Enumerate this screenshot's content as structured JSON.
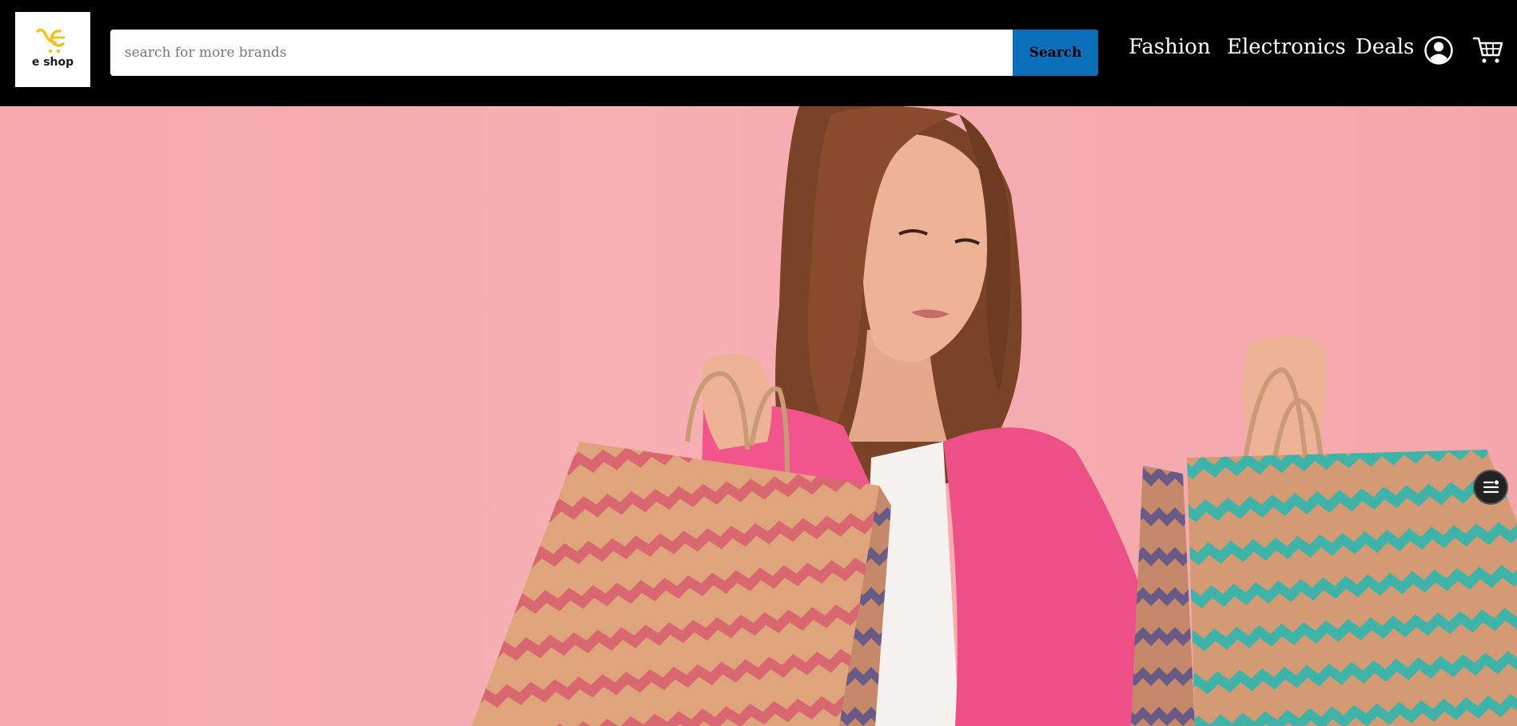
{
  "header": {
    "logo_text": "e shop",
    "search": {
      "placeholder": "search for more brands",
      "value": "",
      "button_label": "Search"
    },
    "nav": {
      "fashion": "Fashion",
      "electronics": "Electronics",
      "deals": "Deals"
    },
    "icons": [
      "user-account-icon",
      "shopping-cart-icon"
    ]
  },
  "hero": {
    "image": "woman-holding-shopping-bags-photo",
    "background_color": "#f4a9ad"
  },
  "floating_button": {
    "icon": "menu-list-icon"
  },
  "colors": {
    "header_bg": "#000000",
    "search_button": "#0a6fb8",
    "logo_accent": "#f2c21b",
    "blazer": "#f0558b"
  }
}
